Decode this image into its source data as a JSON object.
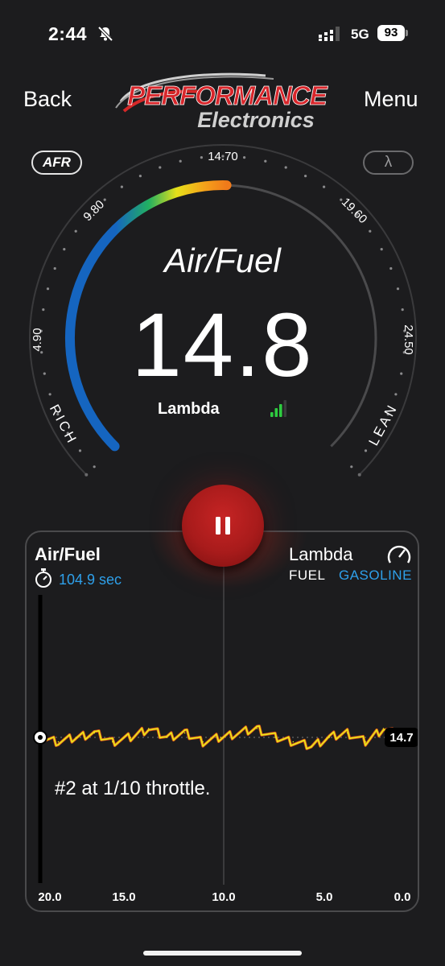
{
  "status_bar": {
    "time": "2:44",
    "network": "5G",
    "battery": "93"
  },
  "header": {
    "back_label": "Back",
    "menu_label": "Menu",
    "logo_line1": "PERFORMANCE",
    "logo_line2": "Electronics"
  },
  "gauge": {
    "mode_afr_label": "AFR",
    "mode_lambda_label": "λ",
    "title": "Air/Fuel",
    "value": "14.8",
    "unit_label": "Lambda",
    "ticks": [
      "4.90",
      "9.80",
      "14.70",
      "19.60",
      "24.50"
    ],
    "rich_label": "RICH",
    "lean_label": "LEAN",
    "scale_min": 4.9,
    "scale_max": 24.5,
    "reading": 14.8,
    "signal_bars": 3
  },
  "chart": {
    "left_title": "Air/Fuel",
    "elapsed": "104.9 sec",
    "right_title": "Lambda",
    "fuel_label": "FUEL",
    "fuel_value": "GASOLINE",
    "annotation": "#2 at 1/10 throttle.",
    "current_value_label": "14.7",
    "x_ticks": [
      "20.0",
      "15.0",
      "10.0",
      "5.0",
      "0.0"
    ]
  },
  "chart_data": {
    "type": "line",
    "x": [
      20,
      19,
      18,
      17,
      16,
      15,
      14,
      13,
      12,
      11,
      10,
      9,
      8,
      7,
      6,
      5,
      4,
      3,
      2,
      1,
      0
    ],
    "series": [
      {
        "values": [
          14.7,
          14.6,
          14.7,
          14.8,
          14.6,
          14.7,
          14.9,
          14.7,
          14.8,
          14.6,
          14.7,
          14.8,
          14.9,
          14.7,
          14.6,
          14.5,
          14.7,
          14.8,
          14.6,
          14.9,
          14.7
        ]
      }
    ],
    "x_ticks": [
      "20.0",
      "15.0",
      "10.0",
      "5.0",
      "0.0"
    ],
    "xlim": [
      20,
      0
    ],
    "current_value": 14.7
  },
  "colors": {
    "accent_blue": "#2ea0ea",
    "pause_red": "#b71f1f",
    "gauge_blue": "#1565c0",
    "signal_green": "#2ecc40"
  },
  "icons": {
    "mute": "bell-slash-icon",
    "timer": "stopwatch-icon",
    "gauge_mode": "speedometer-icon",
    "pause": "pause-icon"
  }
}
